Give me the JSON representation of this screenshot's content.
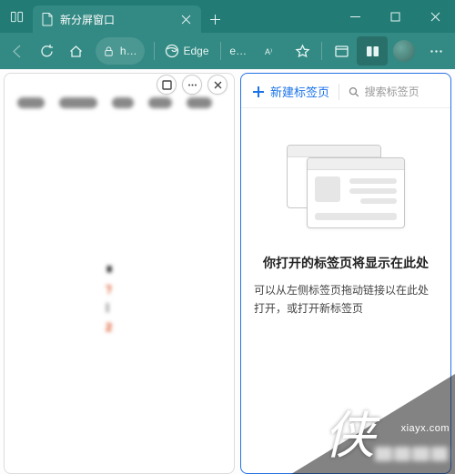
{
  "window": {
    "tab_title": "新分屏窗口"
  },
  "toolbar": {
    "address_text": "h…",
    "edge_label": "Edge",
    "ed_label": "ed…"
  },
  "split_controls": {
    "maximize": "maximize",
    "more": "more",
    "close": "close"
  },
  "right_pane": {
    "new_tab_label": "新建标签页",
    "search_placeholder": "搜索标签页",
    "empty_title": "你打开的标签页将显示在此处",
    "empty_desc": "可以从左侧标签页拖动链接以在此处打开，或打开新标签页"
  },
  "watermark": {
    "char": "侠",
    "url": "xiayx.com"
  }
}
